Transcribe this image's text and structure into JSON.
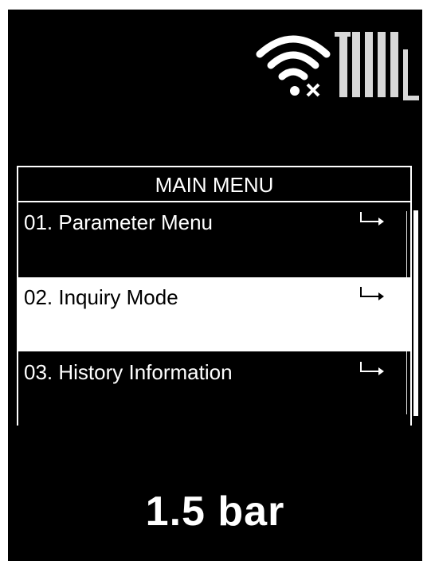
{
  "status": {
    "wifi_icon": "wifi-disconnected-icon",
    "heating_icon": "radiator-icon"
  },
  "menu": {
    "title": "MAIN MENU",
    "items": [
      {
        "label": "01. Parameter Menu",
        "icon": "enter-arrow-icon",
        "selected": false
      },
      {
        "label": "02. Inquiry Mode",
        "icon": "enter-arrow-icon",
        "selected": true
      },
      {
        "label": "03. History Information",
        "icon": "enter-arrow-icon",
        "selected": false
      }
    ]
  },
  "pressure": {
    "value": "1.5 bar"
  },
  "colors": {
    "background": "#000000",
    "foreground": "#ffffff",
    "selected_bg": "#ffffff",
    "selected_fg": "#000000"
  }
}
